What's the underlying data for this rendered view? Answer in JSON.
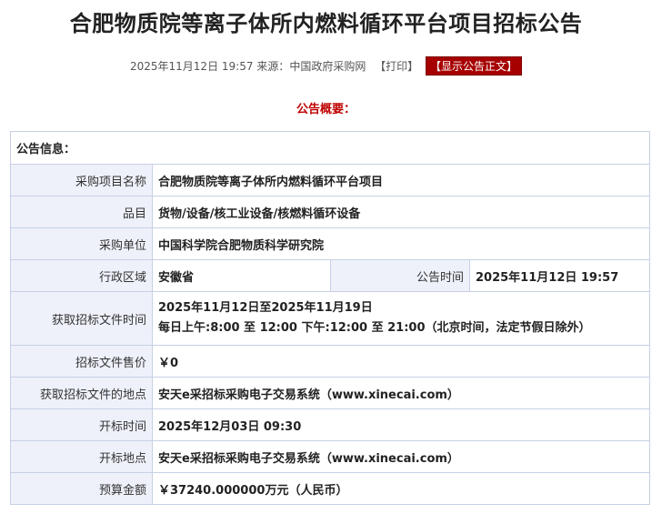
{
  "title": "合肥物质院等离子体所内燃料循环平台项目招标公告",
  "meta": {
    "datetime": "2025年11月12日 19:57",
    "source_label": "来源：",
    "source": "中国政府采购网",
    "print": "【打印】",
    "show_full": "【显示公告正文】"
  },
  "summary_label": "公告概要：",
  "info_label": "公告信息：",
  "rows": {
    "project_name": {
      "label": "采购项目名称",
      "value": "合肥物质院等离子体所内燃料循环平台项目"
    },
    "category": {
      "label": "品目",
      "value": "货物/设备/核工业设备/核燃料循环设备"
    },
    "purchaser": {
      "label": "采购单位",
      "value": "中国科学院合肥物质科学研究院"
    },
    "region": {
      "label": "行政区域",
      "value": "安徽省"
    },
    "announce_time": {
      "label": "公告时间",
      "value": "2025年11月12日  19:57"
    },
    "doc_time": {
      "label": "获取招标文件时间",
      "line1": "2025年11月12日至2025年11月19日",
      "line2": "每日上午:8:00 至 12:00  下午:12:00 至 21:00（北京时间，法定节假日除外）"
    },
    "doc_price": {
      "label": "招标文件售价",
      "value": "￥0"
    },
    "doc_place": {
      "label": "获取招标文件的地点",
      "value": "安天e采招标采购电子交易系统（www.xinecai.com）"
    },
    "open_time": {
      "label": "开标时间",
      "value": "2025年12月03日 09:30"
    },
    "open_place": {
      "label": "开标地点",
      "value": "安天e采招标采购电子交易系统（www.xinecai.com）"
    },
    "budget": {
      "label": "预算金额",
      "value": "￥37240.000000万元（人民币）"
    }
  }
}
